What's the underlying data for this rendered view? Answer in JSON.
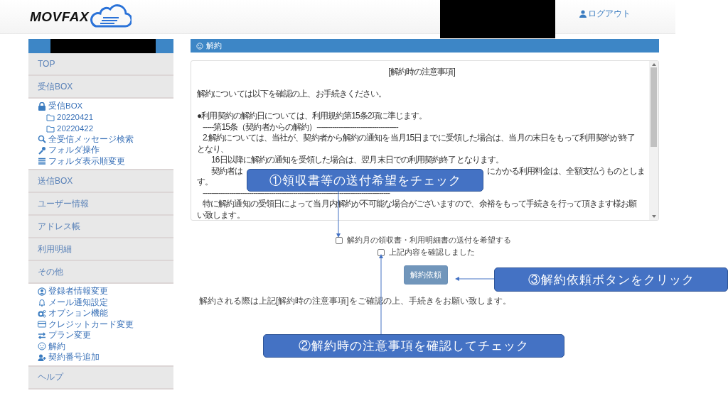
{
  "header": {
    "logo_text": "MOVFAX",
    "logout": "ログアウト"
  },
  "sidebar": {
    "items": [
      {
        "label": "TOP",
        "kind": "section"
      },
      {
        "label": "受信BOX",
        "kind": "section",
        "children": [
          {
            "label": "受信BOX",
            "kind": "inbox",
            "children": [
              {
                "label": "20220421",
                "kind": "folder"
              },
              {
                "label": "20220422",
                "kind": "folder"
              }
            ]
          },
          {
            "label": "全受信メッセージ検索",
            "kind": "search"
          },
          {
            "label": "フォルダ操作",
            "kind": "wrench"
          },
          {
            "label": "フォルダ表示順変更",
            "kind": "list"
          }
        ]
      },
      {
        "label": "送信BOX",
        "kind": "section"
      },
      {
        "label": "ユーザー情報",
        "kind": "section"
      },
      {
        "label": "アドレス帳",
        "kind": "section"
      },
      {
        "label": "利用明細",
        "kind": "section"
      },
      {
        "label": "その他",
        "kind": "section",
        "children": [
          {
            "label": "登録者情報変更",
            "kind": "user-circle"
          },
          {
            "label": "メール通知設定",
            "kind": "bell"
          },
          {
            "label": "オプション機能",
            "kind": "gears"
          },
          {
            "label": "クレジットカード変更",
            "kind": "card"
          },
          {
            "label": "プラン変更",
            "kind": "exchange"
          },
          {
            "label": "解約",
            "kind": "frown"
          },
          {
            "label": "契約番号追加",
            "kind": "user-plus"
          }
        ]
      },
      {
        "label": "ヘルプ",
        "kind": "section"
      }
    ]
  },
  "panel": {
    "title": "解約",
    "notice_lines": [
      {
        "kind": "center",
        "text": "[解約時の注意事項]"
      },
      {
        "kind": "gap"
      },
      {
        "kind": "plain",
        "text": "解約については以下を確認の上、お手続きください。"
      },
      {
        "kind": "gap"
      },
      {
        "kind": "plain",
        "text": "●利用契約の解約日については、利用規約第15条2項に準じます。"
      },
      {
        "kind": "indent",
        "text": "-----第15条（契約者からの解約）-------------------------------------"
      },
      {
        "kind": "indent",
        "text": "2.解約については、当社が、契約者から解約の通知を当月15日までに受領した場合は、当月の末日をもって利用契約が終了"
      },
      {
        "kind": "plain",
        "text": "となり、"
      },
      {
        "kind": "indent2",
        "text": "16日以降に解約の通知を受領した場合は、翌月末日での利用契約終了となります。"
      },
      {
        "kind": "split",
        "text": "契約者は",
        "tail": "にかかる利用料金は、全額支払うものとしま"
      },
      {
        "kind": "plain",
        "text": "す。"
      },
      {
        "kind": "indent",
        "text": "-------------------------------------------------------------------------------------"
      },
      {
        "kind": "indent",
        "text": "特に解約通知の受領日によって当月内解約が不可能な場合がございますので、余裕をもって手続きを行って頂きます様お願"
      },
      {
        "kind": "plain",
        "text": "い致します。"
      }
    ],
    "checkboxes": [
      {
        "label": "解約月の領収書・利用明細書の送付を希望する",
        "checked": false
      },
      {
        "label": "上記内容を確認しました",
        "checked": false
      }
    ],
    "submit": "解約依頼",
    "footnote": "解約される際は上記[解約時の注意事項]をご確認の上、手続きをお願い致します。"
  },
  "callouts": [
    "①領収書等の送付希望をチェック",
    "②解約時の注意事項を確認してチェック",
    "③解約依頼ボタンをクリック"
  ]
}
